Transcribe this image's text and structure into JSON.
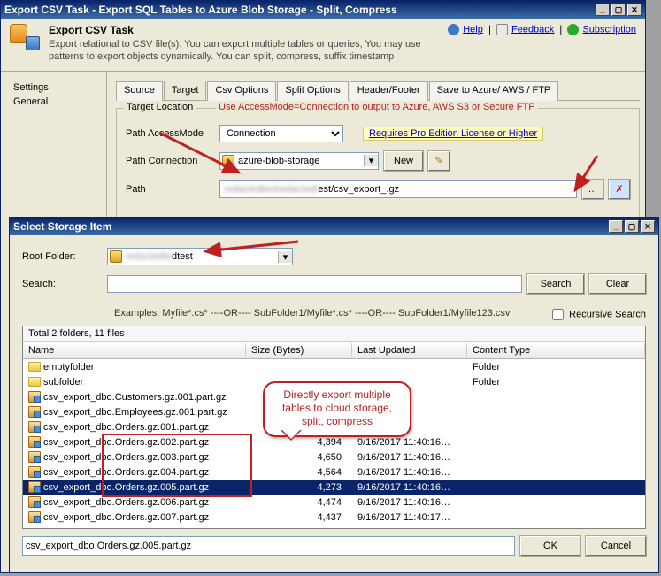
{
  "main_window": {
    "title": "Export CSV Task - Export SQL Tables to Azure Blob Storage - Split, Compress",
    "header_title": "Export CSV Task",
    "header_desc": "Export relational to CSV file(s). You can export multiple tables or queries, You may use patterns to export objects dynamically. You can split, compress, suffix timestamp",
    "links": {
      "help": "Help",
      "feedback": "Feedback",
      "subscription": "Subscription"
    }
  },
  "nav": {
    "items": [
      "Settings",
      "General"
    ]
  },
  "tabs": {
    "items": [
      "Source",
      "Target",
      "Csv Options",
      "Split Options",
      "Header/Footer",
      "Save to Azure/ AWS / FTP"
    ],
    "active": "Target"
  },
  "target_group": {
    "legend": "Target Location",
    "hint": "Use AccessMode=Connection to output to Azure, AWS S3 or Secure FTP",
    "access_mode_label": "Path AccessMode",
    "access_mode_value": "Connection",
    "license_text": "Requires Pro Edition License or Higher",
    "conn_label": "Path Connection",
    "conn_value": "azure-blob-storage",
    "new_btn": "New",
    "path_label": "Path",
    "path_suffix": "est/csv_export_.gz"
  },
  "storage_window": {
    "title": "Select Storage Item",
    "root_label": "Root Folder:",
    "root_suffix": "dtest",
    "search_label": "Search:",
    "search_value": "",
    "search_btn": "Search",
    "clear_btn": "Clear",
    "examples": "Examples:   Myfile*.cs*    ----OR----    SubFolder1/Myfile*.cs*    ----OR----    SubFolder1/Myfile123.csv",
    "recursive_label": "Recursive Search",
    "summary": "Total 2 folders, 11 files",
    "columns": {
      "name": "Name",
      "size": "Size (Bytes)",
      "date": "Last Updated",
      "type": "Content Type"
    },
    "rows": [
      {
        "icon": "folder",
        "name": "emptyfolder",
        "size": "",
        "date": "",
        "type": "Folder"
      },
      {
        "icon": "folder",
        "name": "subfolder",
        "size": "",
        "date": "",
        "type": "Folder"
      },
      {
        "icon": "gz",
        "name": "csv_export_dbo.Customers.gz.001.part.gz",
        "size": "",
        "date": "5…",
        "type": ""
      },
      {
        "icon": "gz",
        "name": "csv_export_dbo.Employees.gz.001.part.gz",
        "size": "",
        "date": "5…",
        "type": ""
      },
      {
        "icon": "gz",
        "name": "csv_export_dbo.Orders.gz.001.part.gz",
        "size": "",
        "date": "6…",
        "type": ""
      },
      {
        "icon": "gz",
        "name": "csv_export_dbo.Orders.gz.002.part.gz",
        "size": "4,394",
        "date": "9/16/2017 11:40:16…",
        "type": ""
      },
      {
        "icon": "gz",
        "name": "csv_export_dbo.Orders.gz.003.part.gz",
        "size": "4,650",
        "date": "9/16/2017 11:40:16…",
        "type": ""
      },
      {
        "icon": "gz",
        "name": "csv_export_dbo.Orders.gz.004.part.gz",
        "size": "4,564",
        "date": "9/16/2017 11:40:16…",
        "type": ""
      },
      {
        "icon": "gz",
        "name": "csv_export_dbo.Orders.gz.005.part.gz",
        "size": "4,273",
        "date": "9/16/2017 11:40:16…",
        "type": "",
        "selected": true
      },
      {
        "icon": "gz",
        "name": "csv_export_dbo.Orders.gz.006.part.gz",
        "size": "4,474",
        "date": "9/16/2017 11:40:16…",
        "type": ""
      },
      {
        "icon": "gz",
        "name": "csv_export_dbo.Orders.gz.007.part.gz",
        "size": "4,437",
        "date": "9/16/2017 11:40:17…",
        "type": ""
      }
    ],
    "filename_value": "csv_export_dbo.Orders.gz.005.part.gz",
    "ok_btn": "OK",
    "cancel_btn": "Cancel"
  },
  "callout_text": "Directly export multiple tables to cloud storage, split, compress"
}
